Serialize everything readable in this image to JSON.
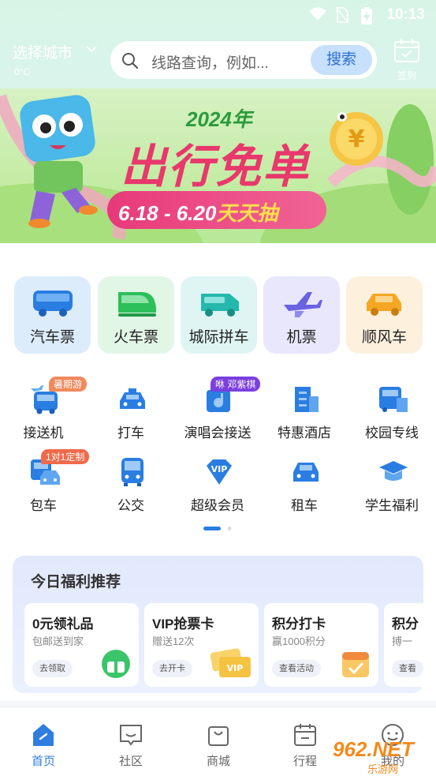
{
  "status": {
    "time": "10:13"
  },
  "header": {
    "city": "选择城市",
    "temperature": "0°C",
    "search_placeholder": "线路查询，例如...",
    "search_button": "搜索",
    "checkin_label": "签到"
  },
  "banner": {
    "year": "2024年",
    "headline": "出行免单",
    "dates": "6.18 - 6.20",
    "draw": "天天抽"
  },
  "primary_services": [
    {
      "label": "汽车票",
      "icon": "bus-icon",
      "bg": "#dcecfb",
      "color": "#2a7de1"
    },
    {
      "label": "火车票",
      "icon": "train-icon",
      "bg": "#e2f6e6",
      "color": "#2cbf5a"
    },
    {
      "label": "城际拼车",
      "icon": "van-icon",
      "bg": "#def5f3",
      "color": "#25b8ac"
    },
    {
      "label": "机票",
      "icon": "plane-icon",
      "bg": "#e8e7fb",
      "color": "#6a62e0"
    },
    {
      "label": "顺风车",
      "icon": "car-icon",
      "bg": "#fdf0dd",
      "color": "#f5a623"
    }
  ],
  "secondary_services": [
    {
      "label": "接送机",
      "icon": "airport-shuttle-icon",
      "badge": "暑期游"
    },
    {
      "label": "打车",
      "icon": "taxi-icon"
    },
    {
      "label": "演唱会接送",
      "icon": "concert-icon",
      "badge": "咻 邓紫棋"
    },
    {
      "label": "特惠酒店",
      "icon": "hotel-icon"
    },
    {
      "label": "校园专线",
      "icon": "campus-bus-icon"
    },
    {
      "label": "包车",
      "icon": "charter-icon",
      "badge": "1对1定制"
    },
    {
      "label": "公交",
      "icon": "city-bus-icon"
    },
    {
      "label": "超级会员",
      "icon": "vip-icon"
    },
    {
      "label": "租车",
      "icon": "rental-car-icon"
    },
    {
      "label": "学生福利",
      "icon": "graduation-cap-icon"
    }
  ],
  "welfare": {
    "title": "今日福利推荐",
    "cards": [
      {
        "title": "0元领礼品",
        "subtitle": "包邮送到家",
        "button": "去领取",
        "icon": "gift-icon"
      },
      {
        "title": "VIP抢票卡",
        "subtitle": "赠送12次",
        "button": "去开卡",
        "icon": "vip-card-icon"
      },
      {
        "title": "积分打卡",
        "subtitle": "赢1000积分",
        "button": "查看活动",
        "icon": "calendar-check-icon"
      },
      {
        "title": "积分",
        "subtitle": "搏一",
        "button": "查看",
        "icon": ""
      }
    ]
  },
  "tabs": [
    {
      "label": "首页",
      "icon": "home-icon",
      "active": true
    },
    {
      "label": "社区",
      "icon": "community-icon",
      "active": false
    },
    {
      "label": "商城",
      "icon": "shop-bag-icon",
      "active": false
    },
    {
      "label": "行程",
      "icon": "calendar-icon",
      "active": false
    },
    {
      "label": "我的",
      "icon": "profile-icon",
      "active": false
    }
  ],
  "watermark": {
    "text": "962.NET",
    "sub": "乐游网"
  },
  "colors": {
    "primary": "#2f7de1",
    "banner_pink": "#e8386c",
    "banner_green": "#2b9b3d"
  }
}
